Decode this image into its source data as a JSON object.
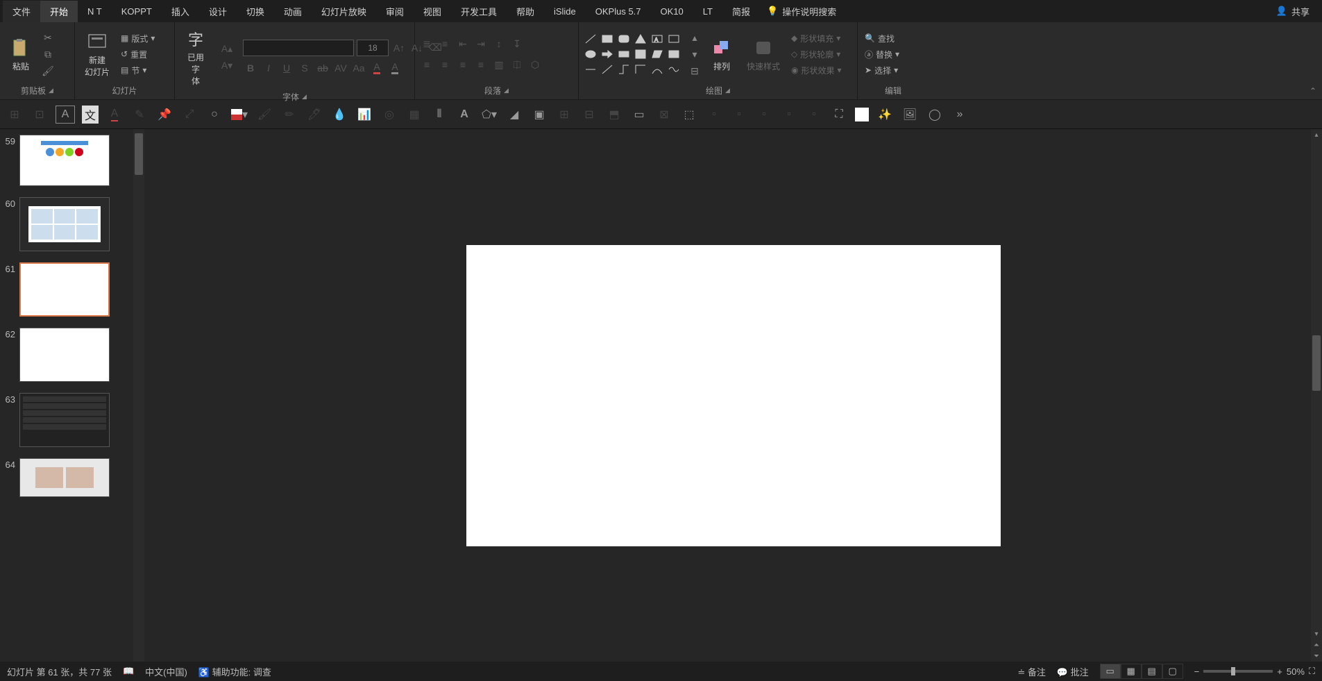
{
  "menu": {
    "file": "文件",
    "home": "开始",
    "nt": "N T",
    "koppt": "KOPPT",
    "insert": "插入",
    "design": "设计",
    "transition": "切换",
    "animation": "动画",
    "slideshow": "幻灯片放映",
    "review": "审阅",
    "view": "视图",
    "devtools": "开发工具",
    "help": "帮助",
    "islide": "iSlide",
    "okplus": "OKPlus 5.7",
    "ok10": "OK10",
    "lt": "LT",
    "brief": "简报",
    "search": "操作说明搜索",
    "share": "共享"
  },
  "ribbon": {
    "clipboard": {
      "paste": "粘贴",
      "label": "剪贴板"
    },
    "slides": {
      "new": "新建\n幻灯片",
      "layout": "版式",
      "reset": "重置",
      "section": "节",
      "label": "幻灯片"
    },
    "font": {
      "usedfont": "已用字\n体",
      "size": "18",
      "label": "字体"
    },
    "paragraph": {
      "label": "段落"
    },
    "drawing": {
      "arrange": "排列",
      "quickstyles": "快速样式",
      "fill": "形状填充",
      "outline": "形状轮廓",
      "effects": "形状效果",
      "label": "绘图"
    },
    "editing": {
      "find": "查找",
      "replace": "替换",
      "select": "选择",
      "label": "编辑"
    }
  },
  "thumbs": [
    {
      "num": "59"
    },
    {
      "num": "60"
    },
    {
      "num": "61",
      "selected": true
    },
    {
      "num": "62"
    },
    {
      "num": "63"
    },
    {
      "num": "64"
    }
  ],
  "status": {
    "slideinfo": "幻灯片 第 61 张，共 77 张",
    "lang": "中文(中国)",
    "a11y": "辅助功能: 调查",
    "notes": "备注",
    "comments": "批注",
    "zoom": "50%"
  }
}
